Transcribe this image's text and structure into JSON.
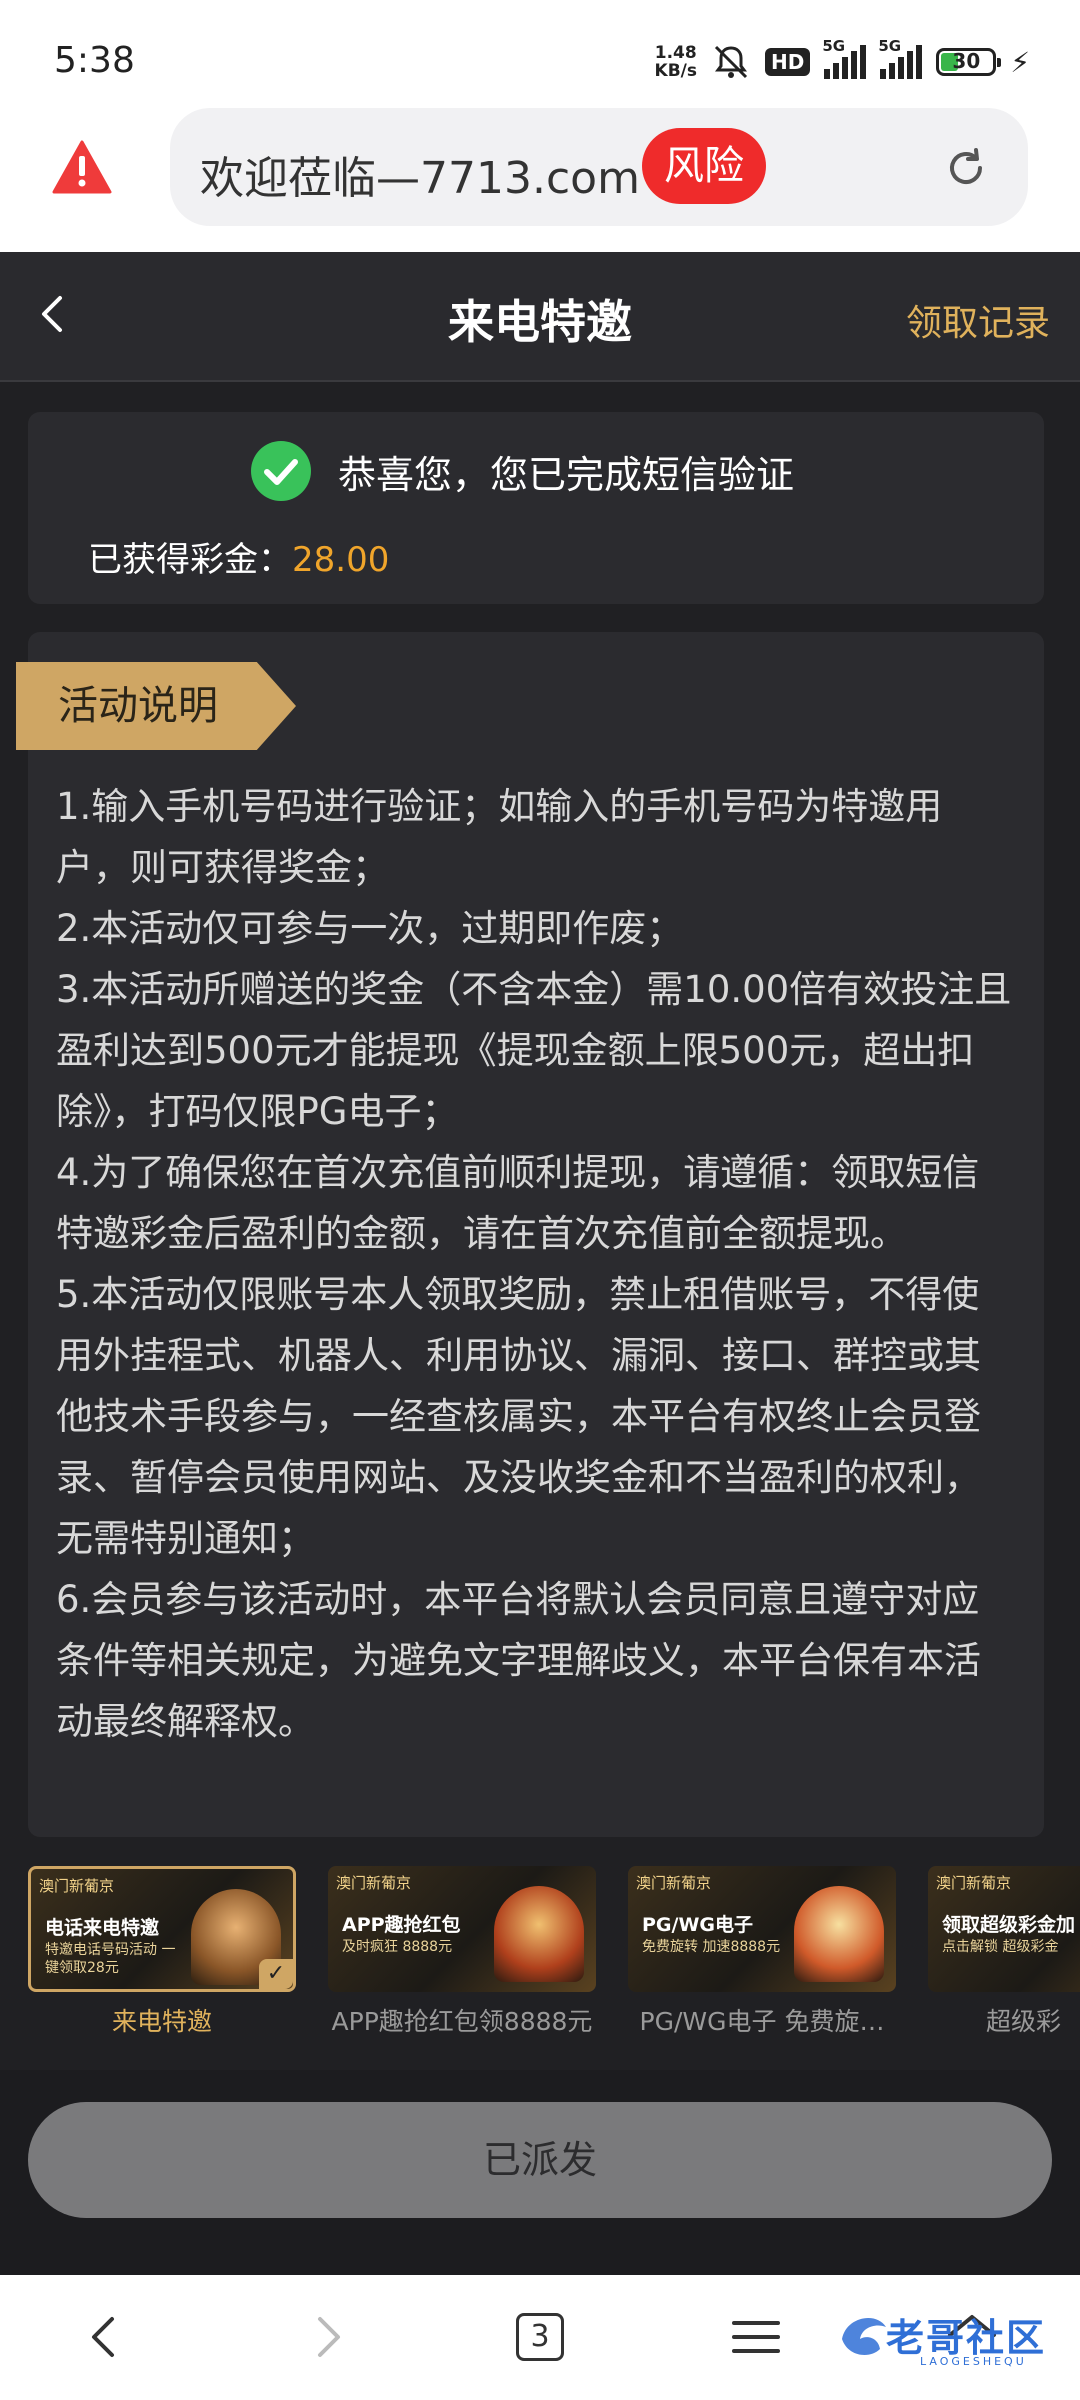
{
  "status_bar": {
    "time": "5:38",
    "network_speed_value": "1.48",
    "network_speed_unit": "KB/s",
    "hd_badge": "HD",
    "signal_1_label": "5G",
    "signal_2_label": "5G",
    "battery": "30",
    "icons": [
      "mute-bell-icon",
      "signal-icon",
      "battery-icon",
      "charging-bolt-icon"
    ]
  },
  "browser": {
    "url_text": "欢迎莅临—7713.com",
    "risk_badge": "风险",
    "icons": [
      "warning-icon",
      "reload-icon"
    ],
    "colors": {
      "risk": "#ef2b2b"
    }
  },
  "header": {
    "title": "来电特邀",
    "right_link": "领取记录",
    "icons": [
      "back-chevron-icon"
    ],
    "colors": {
      "accent": "#e0b25c"
    }
  },
  "success": {
    "message": "恭喜您，您已完成短信验证",
    "bonus_label": "已获得彩金：",
    "bonus_value": "28.00",
    "colors": {
      "check": "#39c25a",
      "bonus": "#f0a52b"
    }
  },
  "rules": {
    "tag": "活动说明",
    "items": [
      "1.输入手机号码进行验证；如输入的手机号码为特邀用户，则可获得奖金；",
      "2.本活动仅可参与一次，过期即作废；",
      "3.本活动所赠送的奖金（不含本金）需10.00倍有效投注且盈利达到500元才能提现《提现金额上限500元，超出扣除》，打码仅限PG电子；",
      "4.为了确保您在首次充值前顺利提现，请遵循：领取短信特邀彩金后盈利的金额，请在首次充值前全额提现。",
      "5.本活动仅限账号本人领取奖励，禁止租借账号，不得使用外挂程式、机器人、利用协议、漏洞、接口、群控或其他技术手段参与，一经查核属实，本平台有权终止会员登录、暂停会员使用网站、及没收奖金和不当盈利的权利，无需特别通知；",
      "6.会员参与该活动时，本平台将默认会员同意且遵守对应条件等相关规定，为避免文字理解歧义，本平台保有本活动最终解释权。"
    ]
  },
  "activities": [
    {
      "label": "来电特邀",
      "image_heading": "电话来电特邀",
      "image_sub": "特邀电话号码活动 一键领取28元",
      "brand": "澳门新葡京",
      "active": true
    },
    {
      "label": "APP趣抢红包领8888元",
      "image_heading": "APP趣抢红包",
      "image_sub": "及时疯狂 8888元",
      "brand": "澳门新葡京",
      "active": false
    },
    {
      "label": "PG/WG电子 免费旋…",
      "image_heading": "PG/WG电子",
      "image_sub": "免费旋转 加速8888元",
      "brand": "澳门新葡京",
      "active": false
    },
    {
      "label": "超级彩",
      "image_heading": "领取超级彩金加",
      "image_sub": "点击解锁 超级彩金",
      "brand": "澳门新葡京",
      "active": false
    }
  ],
  "footer": {
    "button_label": "已派发"
  },
  "bottom_nav": {
    "tab_count": "3",
    "watermark": "老哥社区",
    "watermark_sub": "LAOGESHEQU",
    "icons": [
      "nav-back-icon",
      "nav-forward-icon",
      "tabs-icon",
      "menu-icon",
      "home-icon"
    ]
  }
}
